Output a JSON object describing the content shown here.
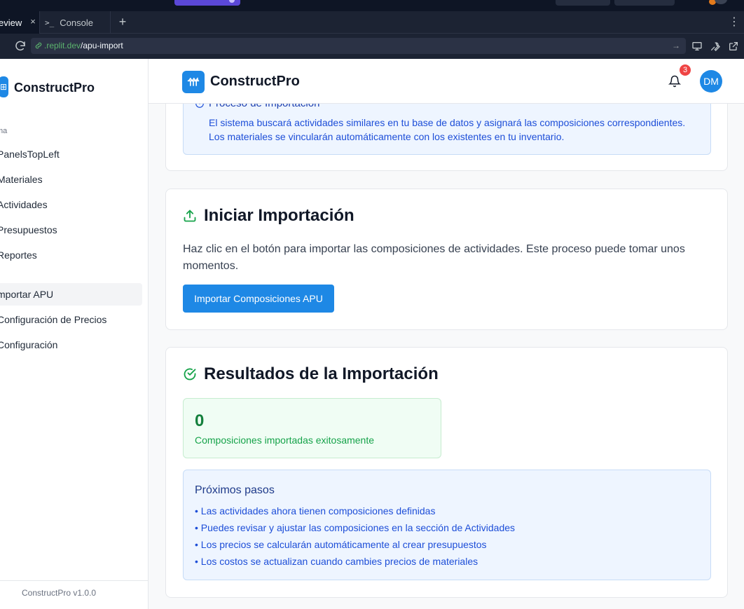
{
  "browser": {
    "tabs": [
      {
        "label": "eview",
        "close": "×"
      },
      {
        "icon_text": ">_",
        "label": "Console"
      }
    ],
    "new_tab": "+",
    "menu": "⋮",
    "url_domain": ".replit.dev",
    "url_path": "/apu-import"
  },
  "sidebar": {
    "brand": "ConstructPro",
    "section_label": "ma",
    "items": [
      {
        "label": "PanelsTopLeft"
      },
      {
        "label": "Materiales"
      },
      {
        "label": "Actividades"
      },
      {
        "label": "Presupuestos"
      },
      {
        "label": "Reportes"
      },
      {
        "label": "mportar APU",
        "active": true
      },
      {
        "label": "Configuración de Precios"
      },
      {
        "label": "Configuración"
      }
    ],
    "footer": "ConstructPro v1.0.0"
  },
  "header": {
    "brand": "ConstructPro",
    "notifications_count": "3",
    "avatar_initials": "DM"
  },
  "process_card": {
    "title": "Proceso de Importación",
    "line1": "El sistema buscará actividades similares en tu base de datos y asignará las composiciones correspondientes.",
    "line2": "Los materiales se vincularán automáticamente con los existentes en tu inventario."
  },
  "import_card": {
    "title": "Iniciar Importación",
    "description": "Haz clic en el botón para importar las composiciones de actividades. Este proceso puede tomar unos momentos.",
    "button_label": "Importar Composiciones APU"
  },
  "results_card": {
    "title": "Resultados de la Importación",
    "count": "0",
    "count_label": "Composiciones importadas exitosamente",
    "next_title": "Próximos pasos",
    "next_steps": [
      "• Las actividades ahora tienen composiciones definidas",
      "• Puedes revisar y ajustar las composiciones en la sección de Actividades",
      "• Los precios se calcularán automáticamente al crear presupuestos",
      "• Los costos se actualizan cuando cambies precios de materiales"
    ]
  },
  "colors": {
    "accent": "#1e88e5",
    "success": "#16a34a",
    "badge": "#ef4444"
  }
}
